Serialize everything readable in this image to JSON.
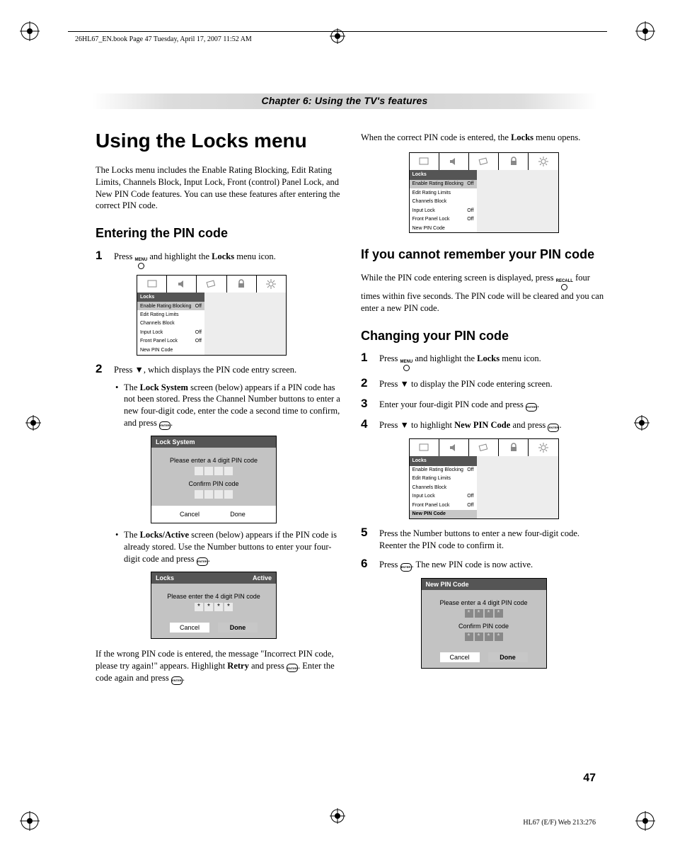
{
  "header": {
    "path": "26HL67_EN.book  Page 47  Tuesday, April 17, 2007  11:52 AM",
    "chapter": "Chapter 6: Using the TV's features"
  },
  "left": {
    "h1": "Using the Locks menu",
    "intro": "The Locks menu includes the Enable Rating Blocking, Edit Rating Limits, Channels Block, Input Lock, Front (control) Panel Lock, and New PIN Code features. You can use these features after entering the correct PIN code.",
    "h2a": "Entering the PIN code",
    "step1a": "Press ",
    "step1b": " and highlight the ",
    "step1c": "Locks",
    "step1d": " menu icon.",
    "button_menu": "MENU",
    "tv1": {
      "title": "Locks",
      "rows": [
        {
          "label": "Enable Rating Blocking",
          "val": "Off",
          "hl": true
        },
        {
          "label": "Edit Rating Limits",
          "val": ""
        },
        {
          "label": "Channels Block",
          "val": ""
        },
        {
          "label": "Input Lock",
          "val": "Off"
        },
        {
          "label": "Front Panel Lock",
          "val": "Off"
        },
        {
          "label": "New PIN Code",
          "val": ""
        }
      ]
    },
    "step2": "Press ▼, which displays the PIN code entry screen.",
    "bullet1a": "The ",
    "bullet1b": "Lock System",
    "bullet1c": " screen (below) appears if a PIN code has not been stored. Press the Channel Number buttons to enter a new four-digit code, enter the code a second time to confirm, and press ",
    "dlg1": {
      "title": "Lock System",
      "line1": "Please enter a 4 digit PIN code",
      "line2": "Confirm PIN code",
      "cancel": "Cancel",
      "done": "Done"
    },
    "bullet2a": "The ",
    "bullet2b": "Locks/Active",
    "bullet2c": " screen (below) appears if the PIN code is already stored. Use the Number buttons to enter your four-digit code and press ",
    "dlg2": {
      "title_l": "Locks",
      "title_r": "Active",
      "line1": "Please enter the 4 digit PIN code",
      "cancel": "Cancel",
      "done": "Done"
    },
    "wrong1": "If the wrong PIN code is entered, the message \"Incorrect PIN code, please try again!\" appears. Highlight ",
    "wrong2": "Retry",
    "wrong3": " and press ",
    "wrong4": ". Enter the code again and press "
  },
  "right": {
    "top1": "When the correct PIN code is entered, the ",
    "top2": "Locks",
    "top3": " menu opens.",
    "tv2": {
      "title": "Locks",
      "rows": [
        {
          "label": "Enable Rating Blocking",
          "val": "Off",
          "hl": true
        },
        {
          "label": "Edit Rating Limits",
          "val": ""
        },
        {
          "label": "Channels Block",
          "val": ""
        },
        {
          "label": "Input Lock",
          "val": "Off"
        },
        {
          "label": "Front Panel Lock",
          "val": "Off"
        },
        {
          "label": "New PIN Code",
          "val": ""
        }
      ]
    },
    "h2b": "If you cannot remember your PIN code",
    "forgot1": "While the PIN code entering screen is displayed, press ",
    "button_recall": "RECALL",
    "forgot2": " four times within five seconds. The PIN code will be cleared and you can enter a new PIN code.",
    "h2c": "Changing your PIN code",
    "cstep1a": "Press ",
    "cstep1b": " and highlight the ",
    "cstep1c": "Locks",
    "cstep1d": " menu icon.",
    "cstep2": "Press ▼ to display the PIN code entering screen.",
    "cstep3": "Enter your four-digit PIN code and press ",
    "cstep4a": "Press ▼ to highlight ",
    "cstep4b": "New PIN Code",
    "cstep4c": " and press ",
    "tv3": {
      "title": "Locks",
      "rows": [
        {
          "label": "Enable Rating Blocking",
          "val": "Off"
        },
        {
          "label": "Edit Rating Limits",
          "val": ""
        },
        {
          "label": "Channels Block",
          "val": ""
        },
        {
          "label": "Input Lock",
          "val": "Off"
        },
        {
          "label": "Front Panel Lock",
          "val": "Off"
        },
        {
          "label": "New PIN Code",
          "val": "",
          "hl": true
        }
      ]
    },
    "cstep5": "Press the Number buttons to enter a new four-digit code. Reenter the PIN code to confirm it.",
    "cstep6a": "Press ",
    "cstep6b": ". The new PIN code is now active.",
    "dlg3": {
      "title": "New PIN Code",
      "line1": "Please enter a 4 digit PIN code",
      "line2": "Confirm PIN code",
      "cancel": "Cancel",
      "done": "Done"
    }
  },
  "page_num": "47",
  "footer": "HL67 (E/F) Web 213:276",
  "enter_label": "ENTER"
}
